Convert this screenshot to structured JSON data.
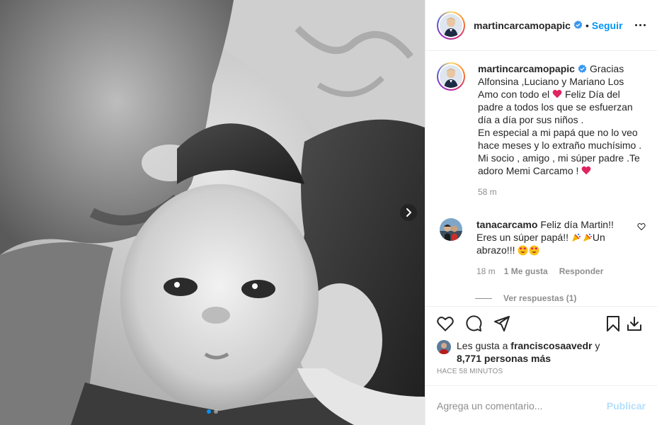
{
  "header": {
    "username": "martincarcamopapic",
    "separator": "•",
    "follow_label": "Seguir",
    "more_icon": "more-horizontal-icon"
  },
  "caption": {
    "username": "martincarcamopapic",
    "text_part1": "Gracias Alfonsina ,Luciano y Mariano Los Amo con todo el",
    "text_part2": "Feliz Día del padre a todos los que se esfuerzan día a día por sus niños .",
    "text_part3": "En especial a mi papá que no lo veo hace meses y lo extraño muchísimo . Mi socio , amigo , mi súper padre .Te adoro Memi Carcamo !",
    "emoji": "red-heart-icon",
    "time": "58 m"
  },
  "comment": {
    "username": "tanacarcamo",
    "text_part1": "Feliz día Martin!! Eres un súper papá!!",
    "text_part2": "Un abrazo!!!",
    "time": "18 m",
    "likes": "1 Me gusta",
    "reply_label": "Responder",
    "view_replies": "Ver respuestas (1)"
  },
  "actions": {
    "like_icon": "heart-outline-icon",
    "comment_icon": "comment-icon",
    "share_icon": "share-icon",
    "save_icon": "bookmark-icon",
    "download_icon": "download-icon"
  },
  "likes": {
    "prefix": "Les gusta a",
    "user": "franciscosaavedr",
    "joiner": "y",
    "count": "8,771 personas más"
  },
  "posted_ago": "HACE 58 MINUTOS",
  "add_comment": {
    "placeholder": "Agrega un comentario...",
    "publish_label": "Publicar"
  },
  "carousel": {
    "current": 1,
    "total": 2
  },
  "colors": {
    "link_blue": "#0095f6",
    "publish_disabled": "#b2dffc",
    "muted": "#8e8e8e",
    "heart_red": "#ed4956"
  }
}
